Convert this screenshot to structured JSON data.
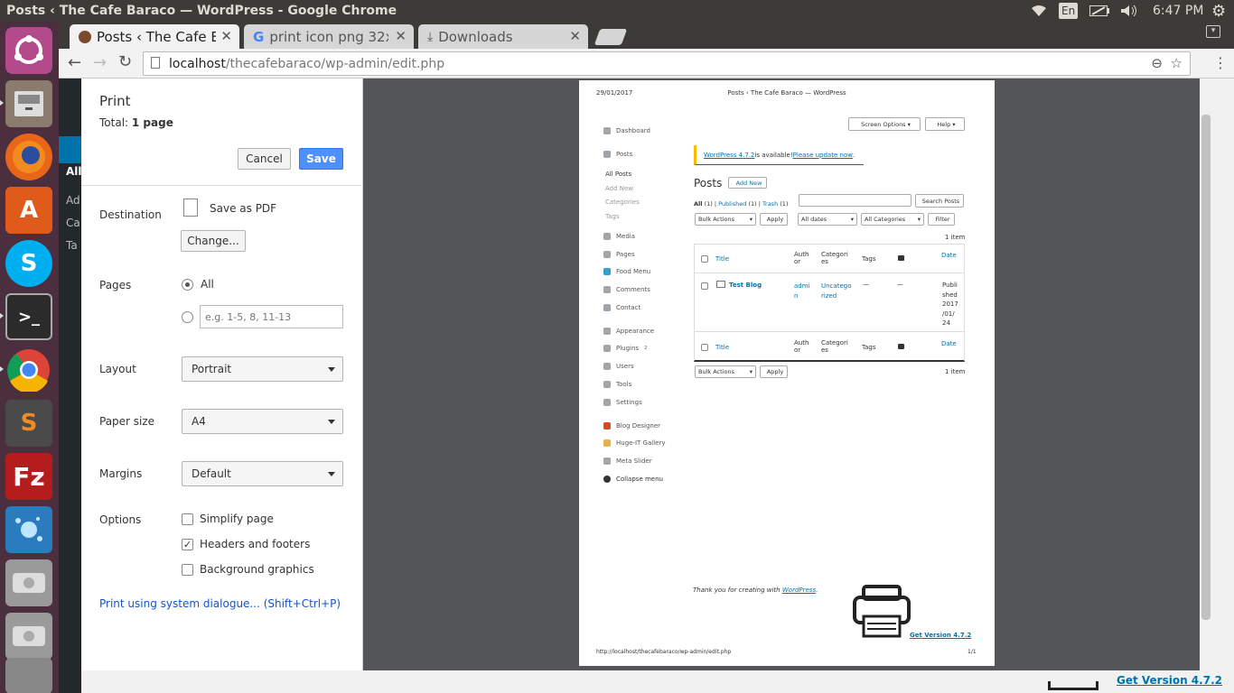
{
  "window_title": "Posts ‹ The Cafe Baraco — WordPress - Google Chrome",
  "indicators": {
    "keyboard": "En",
    "time": "6:47 PM"
  },
  "tabs": [
    {
      "label": "Posts ‹ The Cafe Baraco — WordPress"
    },
    {
      "label": "print icon png 32x32 - Google Search"
    },
    {
      "label": "Downloads"
    }
  ],
  "address": {
    "host": "localhost",
    "path": "/thecafebaraco/wp-admin/edit.php"
  },
  "wp_bg_labels": {
    "all": "All",
    "add": "Ad",
    "cat": "Ca",
    "tag": "Ta",
    "get_version": "Get Version 4.7.2"
  },
  "print": {
    "title": "Print",
    "total_prefix": "Total: ",
    "total_value": "1 page",
    "cancel": "Cancel",
    "save": "Save",
    "destination_label": "Destination",
    "destination_value": "Save as PDF",
    "change": "Change...",
    "pages_label": "Pages",
    "pages_all": "All",
    "pages_placeholder": "e.g. 1-5, 8, 11-13",
    "layout_label": "Layout",
    "layout_value": "Portrait",
    "paper_label": "Paper size",
    "paper_value": "A4",
    "margins_label": "Margins",
    "margins_value": "Default",
    "options_label": "Options",
    "opt_simplify": "Simplify page",
    "opt_headers": "Headers and footers",
    "opt_bg": "Background graphics",
    "system_dialog": "Print using system dialogue... (Shift+Ctrl+P)"
  },
  "preview": {
    "date": "29/01/2017",
    "header_title": "Posts ‹ The Cafe Baraco — WordPress",
    "screen_options": "Screen Options ▾",
    "help": "Help ▾",
    "menu": [
      "Dashboard",
      "Posts",
      "All Posts",
      "Add New",
      "Categories",
      "Tags",
      "Media",
      "Pages",
      "Food Menu",
      "Comments",
      "Contact",
      "Appearance",
      "Plugins",
      "Users",
      "Tools",
      "Settings",
      "Blog Designer",
      "Huge-IT Gallery",
      "Meta Slider",
      "Collapse menu"
    ],
    "plugins_badge": "2",
    "notice_link": "WordPress 4.7.2",
    "notice_text": " is available! ",
    "notice_update": "Please update now",
    "notice_end": ".",
    "posts_heading": "Posts",
    "add_new": "Add New",
    "filter_all": "All",
    "filter_all_count": " (1) | ",
    "filter_published": "Published",
    "filter_published_count": " (1) | ",
    "filter_trash": "Trash",
    "filter_trash_count": " (1)",
    "search_posts": "Search Posts",
    "bulk_actions": "Bulk Actions",
    "apply": "Apply",
    "all_dates": "All dates",
    "all_categories": "All Categories",
    "filter": "Filter",
    "items_count": "1 item",
    "col_title": "Title",
    "col_author": "Auth or",
    "col_categories": "Categori es",
    "col_tags": "Tags",
    "col_date": "Date",
    "row_title": "Test Blog",
    "row_author": "admi n",
    "row_category": "Uncatego rized",
    "row_tags": "—",
    "row_comments": "—",
    "row_date": "Publi shed 2017 /01/ 24",
    "footer_thanks": "Thank you for creating with ",
    "footer_wp": "WordPress",
    "footer_end": ".",
    "get_version": "Get Version 4.7.2",
    "footer_url": "http://localhost/thecafebaraco/wp-admin/edit.php",
    "page_num": "1/1"
  }
}
